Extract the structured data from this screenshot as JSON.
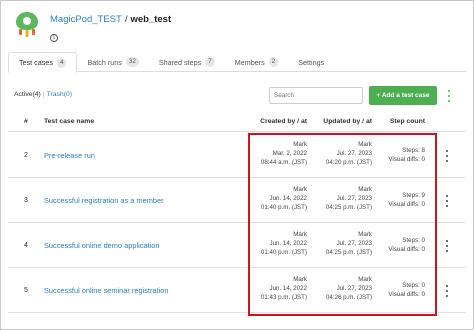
{
  "header": {
    "org": "MagicPod_TEST",
    "separator": "/",
    "project": "web_test",
    "info_icon": "info-icon"
  },
  "tabs": [
    {
      "label": "Test cases",
      "count": "4",
      "active": true
    },
    {
      "label": "Batch runs",
      "count": "32"
    },
    {
      "label": "Shared steps",
      "count": "7"
    },
    {
      "label": "Members",
      "count": "2"
    },
    {
      "label": "Settings",
      "count": ""
    }
  ],
  "filters": {
    "active_label": "Active(4)",
    "divider": "|",
    "trash_label": "Trash(0)"
  },
  "search": {
    "placeholder": "Search"
  },
  "add_button": {
    "label": "+ Add a test case"
  },
  "table": {
    "columns": [
      "#",
      "Test case name",
      "Created by / at",
      "Updated by / at",
      "Step count"
    ],
    "rows": [
      {
        "num": "2",
        "name": "Pre-release run",
        "created_by": "Mark",
        "created_date": "Mar. 2, 2022",
        "created_time": "08:44 a.m. (JST)",
        "updated_by": "Mark",
        "updated_date": "Jul. 27, 2023",
        "updated_time": "04:20 p.m. (JST)",
        "steps": "Steps: 8",
        "visual_diffs": "Visual diffs: 0"
      },
      {
        "num": "3",
        "name": "Successful registration as a member",
        "created_by": "Mark",
        "created_date": "Jun. 14, 2022",
        "created_time": "01:40 p.m. (JST)",
        "updated_by": "Mark",
        "updated_date": "Jul. 27, 2023",
        "updated_time": "04:25 p.m. (JST)",
        "steps": "Steps: 9",
        "visual_diffs": "Visual diffs: 0"
      },
      {
        "num": "4",
        "name": "Successful online demo application",
        "created_by": "Mark",
        "created_date": "Jun. 14, 2022",
        "created_time": "01:40 p.m. (JST)",
        "updated_by": "Mark",
        "updated_date": "Jul. 27, 2023",
        "updated_time": "04:25 p.m. (JST)",
        "steps": "Steps: 0",
        "visual_diffs": "Visual diffs: 0"
      },
      {
        "num": "5",
        "name": "Successful online seminar registration",
        "created_by": "Mark",
        "created_date": "Jun. 14, 2022",
        "created_time": "01:43 p.m. (JST)",
        "updated_by": "Mark",
        "updated_date": "Jul. 27, 2023",
        "updated_time": "04:26 p.m. (JST)",
        "steps": "Steps: 0",
        "visual_diffs": "Visual diffs: 0"
      }
    ]
  },
  "colors": {
    "accent": "#4caf50",
    "link": "#2a7fc1",
    "highlight": "#d0141f"
  }
}
